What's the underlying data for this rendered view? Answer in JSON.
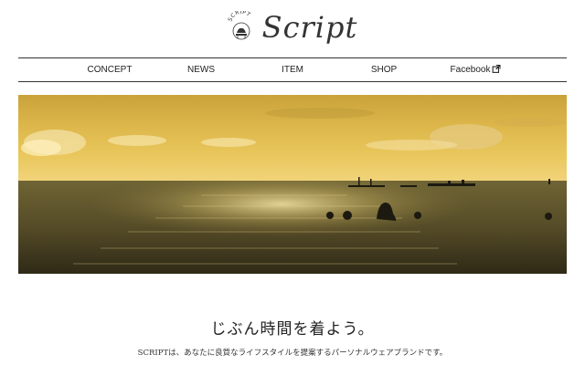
{
  "brand": {
    "name": "Script",
    "badge_text": "SCRIPT"
  },
  "nav": {
    "items": [
      {
        "label": "CONCEPT"
      },
      {
        "label": "NEWS"
      },
      {
        "label": "ITEM"
      },
      {
        "label": "SHOP"
      },
      {
        "label": "Facebook",
        "icon": "external-link-icon"
      }
    ]
  },
  "hero": {
    "image": "sunset-sea-with-swimmers-and-boats"
  },
  "main": {
    "tagline": "じぶん時間を着よう。",
    "description": "SCRIPTは、あなたに良質なライフスタイルを提案するパーソナルウェアブランドです。"
  },
  "colors": {
    "text": "#222222",
    "rule": "#333333",
    "sky": "#e8c24a",
    "sea": "#4a4428"
  }
}
